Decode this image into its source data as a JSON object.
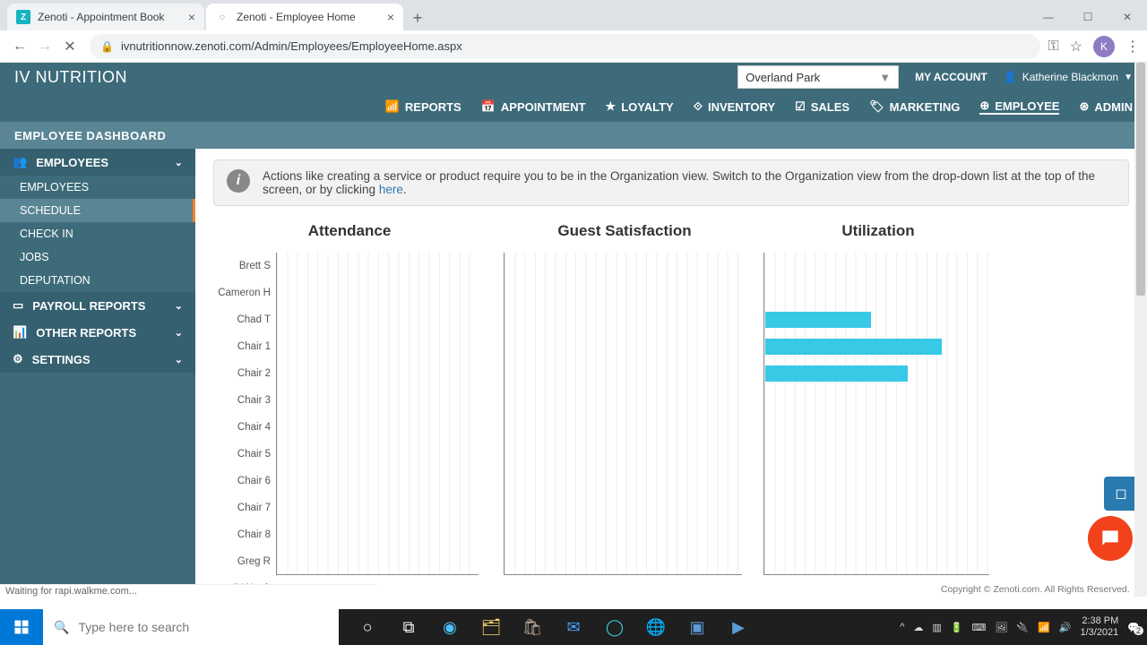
{
  "browser": {
    "tabs": [
      {
        "title": "Zenoti - Appointment Book",
        "favicon_letter": "Z",
        "favicon_bg": "#17b3c1"
      },
      {
        "title": "Zenoti - Employee Home",
        "favicon_letter": "",
        "favicon_bg": "transparent"
      }
    ],
    "url": "ivnutritionnow.zenoti.com/Admin/Employees/EmployeeHome.aspx",
    "avatar_letter": "K",
    "status_text": "Waiting for rapi.walkme.com..."
  },
  "header": {
    "brand": "IV NUTRITION",
    "location": "Overland Park",
    "my_account": "MY ACCOUNT",
    "user_name": "Katherine Blackmon",
    "nav": [
      "REPORTS",
      "APPOINTMENT",
      "LOYALTY",
      "INVENTORY",
      "SALES",
      "MARKETING",
      "EMPLOYEE",
      "ADMIN"
    ],
    "sub_title": "EMPLOYEE DASHBOARD"
  },
  "sidebar": {
    "sections": [
      {
        "label": "EMPLOYEES",
        "items": [
          "EMPLOYEES",
          "SCHEDULE",
          "CHECK IN",
          "JOBS",
          "DEPUTATION"
        ],
        "active_item": 1
      },
      {
        "label": "PAYROLL REPORTS",
        "items": []
      },
      {
        "label": "OTHER REPORTS",
        "items": []
      },
      {
        "label": "SETTINGS",
        "items": []
      }
    ]
  },
  "banner": {
    "text_before": "Actions like creating a service or product require you to be in the Organization view. Switch to the Organization view from the drop-down list at the top of the screen, or by clicking ",
    "link": "here",
    "text_after": "."
  },
  "chart_data": [
    {
      "type": "bar",
      "orientation": "horizontal",
      "title": "Attendance",
      "categories": [
        "Brett S",
        "Cameron H",
        "Chad T",
        "Chair 1",
        "Chair 2",
        "Chair 3",
        "Chair 4",
        "Chair 5",
        "Chair 6",
        "Chair 7",
        "Chair 8",
        "Greg R",
        "IV Nutrit"
      ],
      "values": [
        0,
        0,
        0,
        0,
        0,
        0,
        0,
        0,
        0,
        0,
        0,
        0,
        0
      ],
      "xlim": [
        0,
        100
      ]
    },
    {
      "type": "bar",
      "orientation": "horizontal",
      "title": "Guest Satisfaction",
      "categories": [
        "Brett S",
        "Cameron H",
        "Chad T",
        "Chair 1",
        "Chair 2",
        "Chair 3",
        "Chair 4",
        "Chair 5",
        "Chair 6",
        "Chair 7",
        "Chair 8",
        "Greg R",
        "IV Nutrit"
      ],
      "values": [
        0,
        0,
        0,
        0,
        0,
        0,
        0,
        0,
        0,
        0,
        0,
        0,
        0
      ],
      "xlim": [
        0,
        100
      ]
    },
    {
      "type": "bar",
      "orientation": "horizontal",
      "title": "Utilization",
      "categories": [
        "Brett S",
        "Cameron H",
        "Chad T",
        "Chair 1",
        "Chair 2",
        "Chair 3",
        "Chair 4",
        "Chair 5",
        "Chair 6",
        "Chair 7",
        "Chair 8",
        "Greg R",
        "IV Nutrit"
      ],
      "values": [
        0,
        0,
        47,
        78,
        63,
        0,
        0,
        0,
        0,
        0,
        0,
        0,
        0
      ],
      "xlim": [
        0,
        100
      ],
      "bar_color": "#38c9e6"
    }
  ],
  "footer": {
    "copyright": "Copyright © Zenoti.com. All Rights Reserved. ▼"
  },
  "taskbar": {
    "search_placeholder": "Type here to search",
    "time": "2:38 PM",
    "date": "1/3/2021",
    "notif_count": "2"
  }
}
